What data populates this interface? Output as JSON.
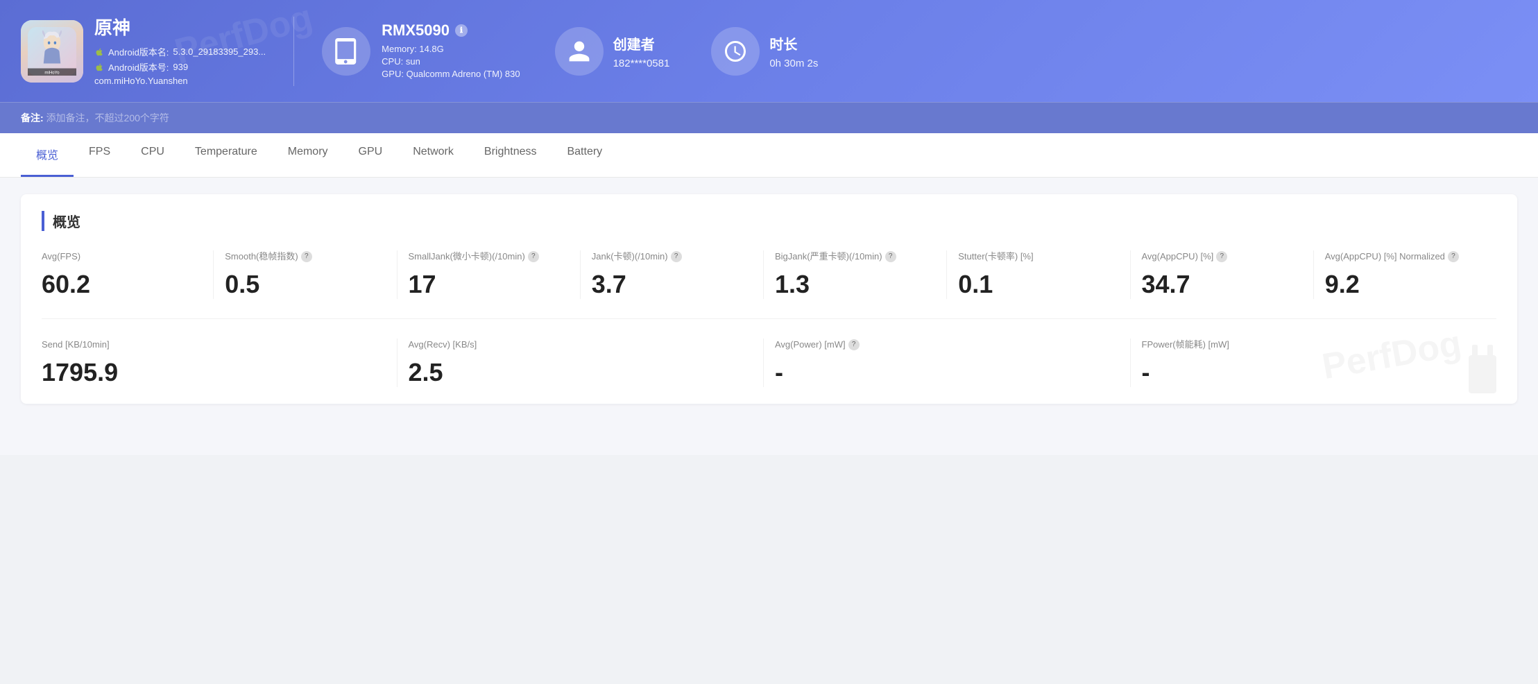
{
  "header": {
    "app": {
      "name": "原神",
      "android_version_name_label": "Android版本名:",
      "android_version_name": "5.3.0_29183395_293...",
      "android_version_no_label": "Android版本号:",
      "android_version_no": "939",
      "package": "com.miHoYo.Yuanshen"
    },
    "device": {
      "name": "RMX5090",
      "memory": "Memory: 14.8G",
      "cpu": "CPU: sun",
      "gpu": "GPU: Qualcomm Adreno (TM) 830"
    },
    "creator": {
      "label": "创建者",
      "value": "182****0581"
    },
    "duration": {
      "label": "时长",
      "value": "0h 30m 2s"
    }
  },
  "notes": {
    "label": "备注:",
    "placeholder": "添加备注，不超过200个字符"
  },
  "nav": {
    "tabs": [
      {
        "id": "overview",
        "label": "概览",
        "active": true
      },
      {
        "id": "fps",
        "label": "FPS",
        "active": false
      },
      {
        "id": "cpu",
        "label": "CPU",
        "active": false
      },
      {
        "id": "temperature",
        "label": "Temperature",
        "active": false
      },
      {
        "id": "memory",
        "label": "Memory",
        "active": false
      },
      {
        "id": "gpu",
        "label": "GPU",
        "active": false
      },
      {
        "id": "network",
        "label": "Network",
        "active": false
      },
      {
        "id": "brightness",
        "label": "Brightness",
        "active": false
      },
      {
        "id": "battery",
        "label": "Battery",
        "active": false
      }
    ]
  },
  "overview": {
    "section_title": "概览",
    "stats": [
      {
        "label": "Avg(FPS)",
        "value": "60.2",
        "has_help": false
      },
      {
        "label": "Smooth(稳帧指数)",
        "value": "0.5",
        "has_help": true
      },
      {
        "label": "SmallJank(微小卡顿)(/10min)",
        "value": "17",
        "has_help": true
      },
      {
        "label": "Jank(卡顿)(/10min)",
        "value": "3.7",
        "has_help": true
      },
      {
        "label": "BigJank(严重卡顿)(/10min)",
        "value": "1.3",
        "has_help": true
      },
      {
        "label": "Stutter(卡顿率) [%]",
        "value": "0.1",
        "has_help": false
      },
      {
        "label": "Avg(AppCPU) [%]",
        "value": "34.7",
        "has_help": true
      },
      {
        "label": "Avg(AppCPU) [%] Normalized",
        "value": "9.2",
        "has_help": true
      }
    ],
    "stats2": [
      {
        "label": "Send [KB/10min]",
        "value": "1795.9",
        "has_help": false
      },
      {
        "label": "Avg(Recv) [KB/s]",
        "value": "2.5",
        "has_help": false
      },
      {
        "label": "Avg(Power) [mW]",
        "value": "-",
        "has_help": true
      },
      {
        "label": "FPower(帧能耗) [mW]",
        "value": "-",
        "has_help": false
      }
    ]
  }
}
